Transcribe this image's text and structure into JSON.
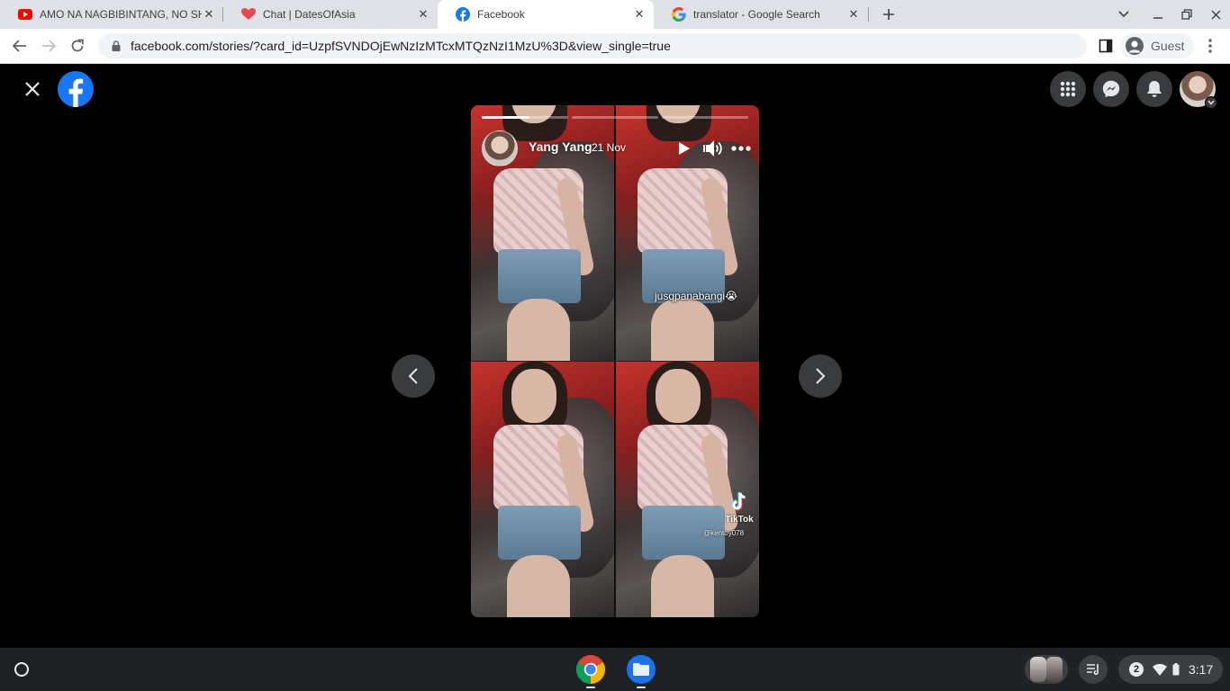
{
  "browser": {
    "tabs": [
      {
        "title": "AMO NA NAGBIBINTANG, NO SH",
        "favicon": "youtube-icon",
        "active": false
      },
      {
        "title": "Chat | DatesOfAsia",
        "favicon": "heart-icon",
        "active": false
      },
      {
        "title": "Facebook",
        "favicon": "facebook-icon",
        "active": true
      },
      {
        "title": "translator - Google Search",
        "favicon": "google-icon",
        "active": false
      }
    ],
    "url": "facebook.com/stories/?card_id=UzpfSVNDOjEwNzIzMTcxMTQzNzI1MzU%3D&view_single=true",
    "profile_label": "Guest"
  },
  "story": {
    "author": "Yang Yang",
    "date": "21 Nov",
    "caption": "jusqpanabangi😭",
    "watermark": "TikTok",
    "handle": "@kentoy078",
    "segments": [
      {
        "progress": 0.55
      },
      {
        "progress": 0
      },
      {
        "progress": 0
      }
    ]
  },
  "shelf": {
    "notification_count": "2",
    "time": "3:17",
    "apps": [
      "chrome-icon",
      "files-icon"
    ]
  },
  "colors": {
    "facebook_blue": "#1877f2",
    "page_bg": "#000000",
    "button_bg": "#3a3b3c"
  }
}
